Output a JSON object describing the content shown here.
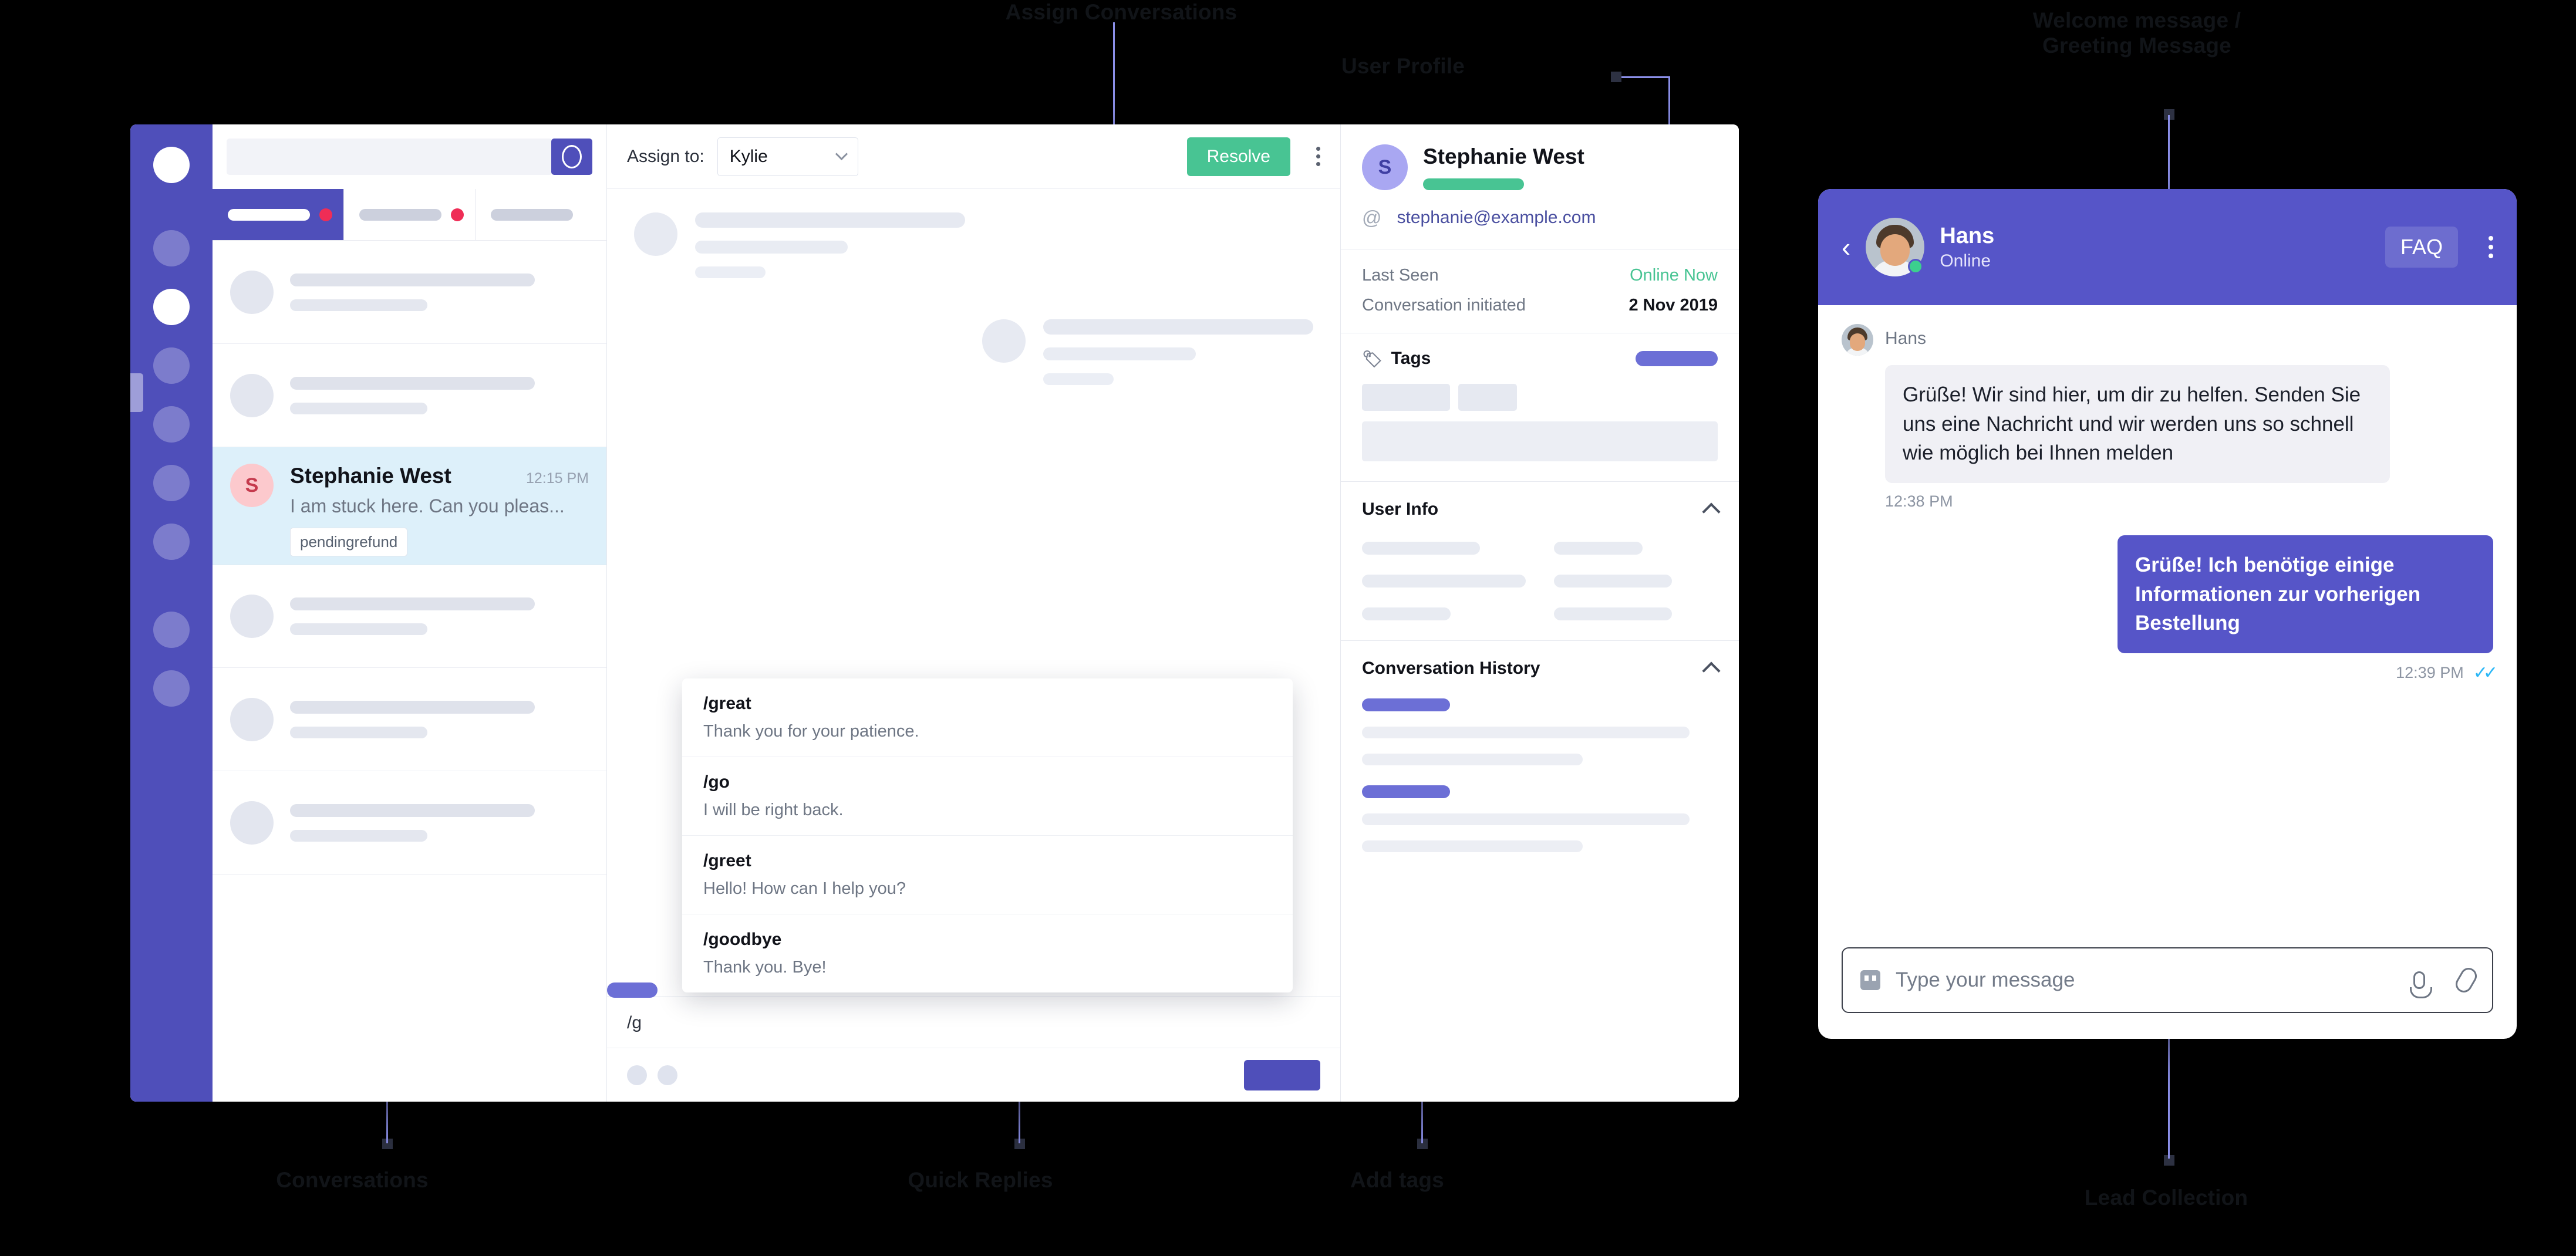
{
  "callouts": [
    {
      "id": "assign",
      "text": "Assign Conversations"
    },
    {
      "id": "user_profile",
      "text": "User Profile"
    },
    {
      "id": "welcome",
      "text": "Welcome message /\nGreeting Message"
    },
    {
      "id": "conversations",
      "text": "Conversations"
    },
    {
      "id": "quick_replies",
      "text": "Quick Replies"
    },
    {
      "id": "add_tags",
      "text": "Add tags"
    },
    {
      "id": "lead_collection",
      "text": "Lead Collection"
    }
  ],
  "colors": {
    "brand_purple": "#4f4fba",
    "widget_purple": "#5655c8",
    "accent_green": "#48c493",
    "badge_red": "#ef2d56",
    "selected_row": "#ddf0fa"
  },
  "conversation_list": {
    "search": {
      "placeholder": "",
      "value": "",
      "button_icon": "search-icon"
    },
    "tabs": [
      {
        "label": "",
        "selected": true,
        "has_badge": true
      },
      {
        "label": "",
        "selected": false,
        "has_badge": true
      },
      {
        "label": "",
        "selected": false,
        "has_badge": false
      }
    ],
    "selected_conversation": {
      "avatar_initial": "S",
      "name": "Stephanie West",
      "time": "12:15 PM",
      "preview": "I am stuck here. Can you pleas...",
      "tag": "pendingrefund"
    },
    "skeleton_rows_above": 2,
    "skeleton_rows_below": 3
  },
  "thread": {
    "assign_label": "Assign to:",
    "assign_value": "Kylie",
    "resolve_label": "Resolve",
    "menu_icon": "kebab-menu-icon",
    "compose_value": "/g",
    "send_label": ""
  },
  "quick_replies": [
    {
      "command": "/great",
      "text": "Thank you for your patience."
    },
    {
      "command": "/go",
      "text": "I will be right back."
    },
    {
      "command": "/greet",
      "text": "Hello! How can I help you?"
    },
    {
      "command": "/goodbye",
      "text": "Thank you. Bye!"
    }
  ],
  "profile": {
    "avatar_initial": "S",
    "name": "Stephanie West",
    "email": "stephanie@example.com",
    "email_icon": "at-icon",
    "meta": [
      {
        "key": "Last Seen",
        "value": "Online Now",
        "highlight": true
      },
      {
        "key": "Conversation initiated",
        "value": "2 Nov 2019",
        "highlight": false
      }
    ],
    "tags_section": {
      "title": "Tags",
      "icon": "tag-icon",
      "add_label": ""
    },
    "user_info_section": {
      "title": "User Info",
      "collapse_icon": "chevron-up-icon"
    },
    "history_section": {
      "title": "Conversation History",
      "collapse_icon": "chevron-up-icon"
    }
  },
  "widget": {
    "back_icon": "chevron-left-icon",
    "agent_name": "Hans",
    "agent_status": "Online",
    "faq_label": "FAQ",
    "menu_icon": "kebab-menu-icon",
    "messages": [
      {
        "direction": "in",
        "sender": "Hans",
        "text": "Grüße! Wir sind hier, um dir zu helfen. Senden Sie uns eine Nachricht und wir werden uns so schnell wie möglich bei Ihnen melden",
        "time": "12:38 PM"
      },
      {
        "direction": "out",
        "sender": "",
        "text": "Grüße! Ich benötige einige Informationen zur vorherigen Bestellung",
        "time": "12:39 PM",
        "read_receipt": "✓✓"
      }
    ],
    "input": {
      "placeholder": "Type your message",
      "bot_icon": "bot-icon",
      "mic_icon": "microphone-icon",
      "attach_icon": "paperclip-icon"
    }
  }
}
